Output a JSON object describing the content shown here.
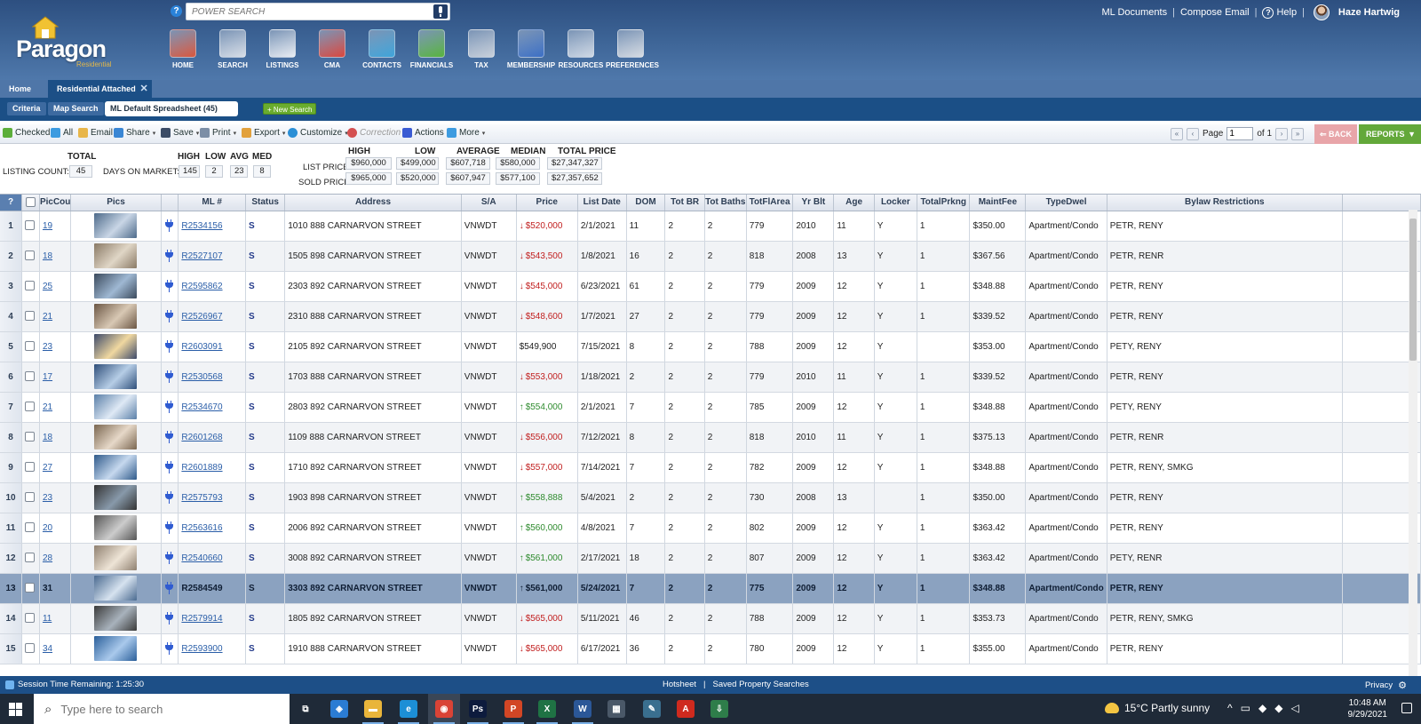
{
  "header": {
    "logo_text": "Paragon",
    "logo_sub": "Residential",
    "power_search_placeholder": "POWER SEARCH",
    "links": {
      "ml_documents": "ML Documents",
      "compose_email": "Compose Email",
      "help": "Help",
      "user": "Haze Hartwig"
    },
    "nav": [
      {
        "label": "HOME",
        "icon": "house-icon",
        "color": "#d9573e"
      },
      {
        "label": "SEARCH",
        "icon": "magnifier-document-icon",
        "color": "#d7dde6"
      },
      {
        "label": "LISTINGS",
        "icon": "clipboard-icon",
        "color": "#e8ecf2"
      },
      {
        "label": "CMA",
        "icon": "cma-chart-icon",
        "color": "#d9473e"
      },
      {
        "label": "CONTACTS",
        "icon": "people-icon",
        "color": "#3fa4d9"
      },
      {
        "label": "FINANCIALS",
        "icon": "pie-chart-icon",
        "color": "#58b33e"
      },
      {
        "label": "TAX",
        "icon": "coins-icon",
        "color": "#c9d0da"
      },
      {
        "label": "MEMBERSHIP",
        "icon": "globe-icon",
        "color": "#3c6fc4"
      },
      {
        "label": "RESOURCES",
        "icon": "cabinet-icon",
        "color": "#cfd8e4"
      },
      {
        "label": "PREFERENCES",
        "icon": "tools-icon",
        "color": "#d6dbe2"
      }
    ]
  },
  "tabs": {
    "home": "Home",
    "residential_attached": "Residential Attached",
    "close": "✕"
  },
  "subtabs": {
    "criteria": "Criteria",
    "map_search": "Map Search",
    "spreadsheet": "ML Default Spreadsheet (45)",
    "new_search": "+ New Search"
  },
  "toolbar": {
    "checked": "Checked",
    "all": "All",
    "email": "Email",
    "share": "Share",
    "save": "Save",
    "print": "Print",
    "export": "Export",
    "customize": "Customize",
    "correction": "Correction",
    "actions": "Actions",
    "more": "More",
    "page_label": "Page",
    "page_value": "1",
    "of_label": "of 1",
    "back": "BACK",
    "reports": "REPORTS"
  },
  "stats": {
    "total_head": "TOTAL",
    "listing_count_label": "LISTING COUNT:",
    "listing_count": "45",
    "dom_label": "DAYS ON MARKET:",
    "high_h": "HIGH",
    "low_h": "LOW",
    "avg_h": "AVG",
    "med_h": "MED",
    "dom_high": "145",
    "dom_low": "2",
    "dom_avg": "23",
    "dom_med": "8",
    "price_heads": {
      "high": "HIGH",
      "low": "LOW",
      "average": "AVERAGE",
      "median": "MEDIAN",
      "total": "TOTAL PRICE"
    },
    "list_label": "LIST PRICE:",
    "sold_label": "SOLD PRICE:",
    "list": [
      "$960,000",
      "$499,000",
      "$607,718",
      "$580,000",
      "$27,347,327"
    ],
    "sold": [
      "$965,000",
      "$520,000",
      "$607,947",
      "$577,100",
      "$27,357,652"
    ]
  },
  "columns": [
    "?",
    "",
    "PicCou",
    "Pics",
    "",
    "ML #",
    "Status",
    "Address",
    "S/A",
    "Price",
    "List Date",
    "DOM",
    "Tot BR",
    "Tot Baths",
    "TotFlArea",
    "Yr Blt",
    "Age",
    "Locker",
    "TotalPrkng",
    "MaintFee",
    "TypeDwel",
    "Bylaw Restrictions"
  ],
  "rows": [
    {
      "n": "1",
      "pic": "19",
      "ml": "R2534156",
      "status": "S",
      "addr": "1010 888 CARNARVON STREET",
      "sa": "VNWDT",
      "price": "$520,000",
      "dir": "down",
      "date": "2/1/2021",
      "dom": "11",
      "br": "2",
      "ba": "2",
      "area": "779",
      "yr": "2010",
      "age": "11",
      "locker": "Y",
      "prk": "1",
      "fee": "$350.00",
      "type": "Apartment/Condo",
      "bylaw": "PETR, RENY"
    },
    {
      "n": "2",
      "pic": "18",
      "ml": "R2527107",
      "status": "S",
      "addr": "1505 898 CARNARVON STREET",
      "sa": "VNWDT",
      "price": "$543,500",
      "dir": "down",
      "date": "1/8/2021",
      "dom": "16",
      "br": "2",
      "ba": "2",
      "area": "818",
      "yr": "2008",
      "age": "13",
      "locker": "Y",
      "prk": "1",
      "fee": "$367.56",
      "type": "Apartment/Condo",
      "bylaw": "PETR, RENR"
    },
    {
      "n": "3",
      "pic": "25",
      "ml": "R2595862",
      "status": "S",
      "addr": "2303 892 CARNARVON STREET",
      "sa": "VNWDT",
      "price": "$545,000",
      "dir": "down",
      "date": "6/23/2021",
      "dom": "61",
      "br": "2",
      "ba": "2",
      "area": "779",
      "yr": "2009",
      "age": "12",
      "locker": "Y",
      "prk": "1",
      "fee": "$348.88",
      "type": "Apartment/Condo",
      "bylaw": "PETR, RENY"
    },
    {
      "n": "4",
      "pic": "21",
      "ml": "R2526967",
      "status": "S",
      "addr": "2310 888 CARNARVON STREET",
      "sa": "VNWDT",
      "price": "$548,600",
      "dir": "down",
      "date": "1/7/2021",
      "dom": "27",
      "br": "2",
      "ba": "2",
      "area": "779",
      "yr": "2009",
      "age": "12",
      "locker": "Y",
      "prk": "1",
      "fee": "$339.52",
      "type": "Apartment/Condo",
      "bylaw": "PETR, RENY"
    },
    {
      "n": "5",
      "pic": "23",
      "ml": "R2603091",
      "status": "S",
      "addr": "2105 892 CARNARVON STREET",
      "sa": "VNWDT",
      "price": "$549,900",
      "dir": "none",
      "date": "7/15/2021",
      "dom": "8",
      "br": "2",
      "ba": "2",
      "area": "788",
      "yr": "2009",
      "age": "12",
      "locker": "Y",
      "prk": "",
      "fee": "$353.00",
      "type": "Apartment/Condo",
      "bylaw": "PETY, RENY"
    },
    {
      "n": "6",
      "pic": "17",
      "ml": "R2530568",
      "status": "S",
      "addr": "1703 888 CARNARVON STREET",
      "sa": "VNWDT",
      "price": "$553,000",
      "dir": "down",
      "date": "1/18/2021",
      "dom": "2",
      "br": "2",
      "ba": "2",
      "area": "779",
      "yr": "2010",
      "age": "11",
      "locker": "Y",
      "prk": "1",
      "fee": "$339.52",
      "type": "Apartment/Condo",
      "bylaw": "PETR, RENY"
    },
    {
      "n": "7",
      "pic": "21",
      "ml": "R2534670",
      "status": "S",
      "addr": "2803 892 CARNARVON STREET",
      "sa": "VNWDT",
      "price": "$554,000",
      "dir": "up",
      "date": "2/1/2021",
      "dom": "7",
      "br": "2",
      "ba": "2",
      "area": "785",
      "yr": "2009",
      "age": "12",
      "locker": "Y",
      "prk": "1",
      "fee": "$348.88",
      "type": "Apartment/Condo",
      "bylaw": "PETY, RENY"
    },
    {
      "n": "8",
      "pic": "18",
      "ml": "R2601268",
      "status": "S",
      "addr": "1109 888 CARNARVON STREET",
      "sa": "VNWDT",
      "price": "$556,000",
      "dir": "down",
      "date": "7/12/2021",
      "dom": "8",
      "br": "2",
      "ba": "2",
      "area": "818",
      "yr": "2010",
      "age": "11",
      "locker": "Y",
      "prk": "1",
      "fee": "$375.13",
      "type": "Apartment/Condo",
      "bylaw": "PETR, RENR"
    },
    {
      "n": "9",
      "pic": "27",
      "ml": "R2601889",
      "status": "S",
      "addr": "1710 892 CARNARVON STREET",
      "sa": "VNWDT",
      "price": "$557,000",
      "dir": "down",
      "date": "7/14/2021",
      "dom": "7",
      "br": "2",
      "ba": "2",
      "area": "782",
      "yr": "2009",
      "age": "12",
      "locker": "Y",
      "prk": "1",
      "fee": "$348.88",
      "type": "Apartment/Condo",
      "bylaw": "PETR, RENY, SMKG"
    },
    {
      "n": "10",
      "pic": "23",
      "ml": "R2575793",
      "status": "S",
      "addr": "1903 898 CARNARVON STREET",
      "sa": "VNWDT",
      "price": "$558,888",
      "dir": "up",
      "date": "5/4/2021",
      "dom": "2",
      "br": "2",
      "ba": "2",
      "area": "730",
      "yr": "2008",
      "age": "13",
      "locker": "",
      "prk": "1",
      "fee": "$350.00",
      "type": "Apartment/Condo",
      "bylaw": "PETR, RENY"
    },
    {
      "n": "11",
      "pic": "20",
      "ml": "R2563616",
      "status": "S",
      "addr": "2006 892 CARNARVON STREET",
      "sa": "VNWDT",
      "price": "$560,000",
      "dir": "up",
      "date": "4/8/2021",
      "dom": "7",
      "br": "2",
      "ba": "2",
      "area": "802",
      "yr": "2009",
      "age": "12",
      "locker": "Y",
      "prk": "1",
      "fee": "$363.42",
      "type": "Apartment/Condo",
      "bylaw": "PETR, RENY"
    },
    {
      "n": "12",
      "pic": "28",
      "ml": "R2540660",
      "status": "S",
      "addr": "3008 892 CARNARVON STREET",
      "sa": "VNWDT",
      "price": "$561,000",
      "dir": "up",
      "date": "2/17/2021",
      "dom": "18",
      "br": "2",
      "ba": "2",
      "area": "807",
      "yr": "2009",
      "age": "12",
      "locker": "Y",
      "prk": "1",
      "fee": "$363.42",
      "type": "Apartment/Condo",
      "bylaw": "PETY, RENR"
    },
    {
      "n": "13",
      "pic": "31",
      "ml": "R2584549",
      "status": "S",
      "addr": "3303 892 CARNARVON STREET",
      "sa": "VNWDT",
      "price": "$561,000",
      "dir": "up",
      "date": "5/24/2021",
      "dom": "7",
      "br": "2",
      "ba": "2",
      "area": "775",
      "yr": "2009",
      "age": "12",
      "locker": "Y",
      "prk": "1",
      "fee": "$348.88",
      "type": "Apartment/Condo",
      "bylaw": "PETR, RENY",
      "selected": true
    },
    {
      "n": "14",
      "pic": "11",
      "ml": "R2579914",
      "status": "S",
      "addr": "1805 892 CARNARVON STREET",
      "sa": "VNWDT",
      "price": "$565,000",
      "dir": "down",
      "date": "5/11/2021",
      "dom": "46",
      "br": "2",
      "ba": "2",
      "area": "788",
      "yr": "2009",
      "age": "12",
      "locker": "Y",
      "prk": "1",
      "fee": "$353.73",
      "type": "Apartment/Condo",
      "bylaw": "PETR, RENY, SMKG"
    },
    {
      "n": "15",
      "pic": "34",
      "ml": "R2593900",
      "status": "S",
      "addr": "1910 888 CARNARVON STREET",
      "sa": "VNWDT",
      "price": "$565,000",
      "dir": "down",
      "date": "6/17/2021",
      "dom": "36",
      "br": "2",
      "ba": "2",
      "area": "780",
      "yr": "2009",
      "age": "12",
      "locker": "Y",
      "prk": "1",
      "fee": "$355.00",
      "type": "Apartment/Condo",
      "bylaw": "PETR, RENY"
    }
  ],
  "statusbar": {
    "session": "Session Time Remaining: 1:25:30",
    "hotsheet": "Hotsheet",
    "saved": "Saved Property Searches",
    "privacy": "Privacy"
  },
  "taskbar": {
    "search_placeholder": "Type here to search",
    "weather": "15°C  Partly sunny",
    "time": "10:48 AM",
    "date": "9/29/2021",
    "apps": [
      {
        "name": "task-view-icon",
        "color": "#1f2a38",
        "label": "⧉"
      },
      {
        "name": "store-icon",
        "color": "#2b7cd3",
        "label": "◈"
      },
      {
        "name": "file-explorer-icon",
        "color": "#e9b53b",
        "label": "▬"
      },
      {
        "name": "edge-icon",
        "color": "#1c8fd6",
        "label": "e"
      },
      {
        "name": "chrome-icon",
        "color": "#d94336",
        "label": "◉"
      },
      {
        "name": "photoshop-icon",
        "color": "#0d1b3d",
        "label": "Ps"
      },
      {
        "name": "powerpoint-icon",
        "color": "#d24625",
        "label": "P"
      },
      {
        "name": "excel-icon",
        "color": "#1f7244",
        "label": "X"
      },
      {
        "name": "word-icon",
        "color": "#2b5797",
        "label": "W"
      },
      {
        "name": "calculator-icon",
        "color": "#4a5868",
        "label": "▦"
      },
      {
        "name": "pen-tool-icon",
        "color": "#3a6f8f",
        "label": "✎"
      },
      {
        "name": "acrobat-icon",
        "color": "#cf2a1e",
        "label": "A"
      },
      {
        "name": "installer-icon",
        "color": "#2e7d4a",
        "label": "⇩"
      }
    ]
  }
}
